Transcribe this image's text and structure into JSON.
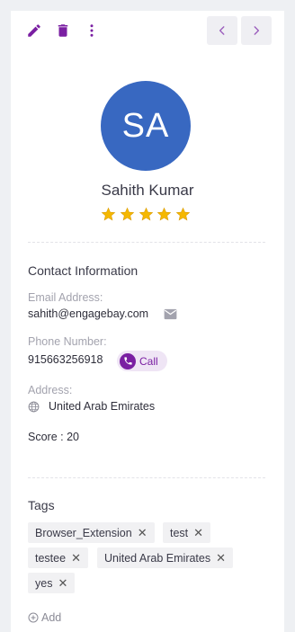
{
  "contact": {
    "initials": "SA",
    "name": "Sahith Kumar",
    "rating": 5
  },
  "contact_info": {
    "title": "Contact Information",
    "email_label": "Email Address:",
    "email": "sahith@engagebay.com",
    "phone_label": "Phone Number:",
    "phone": "915663256918",
    "call_label": "Call",
    "address_label": "Address:",
    "address": "United Arab Emirates",
    "score": "Score : 20"
  },
  "tags": {
    "title": "Tags",
    "items": [
      "Browser_Extension",
      "test",
      "testee",
      "United Arab Emirates",
      "yes"
    ],
    "add_label": "Add"
  },
  "colors": {
    "accent": "#7a1fa2",
    "avatar": "#3868c1",
    "star": "#f5b800"
  },
  "icons": [
    "edit-icon",
    "delete-icon",
    "more-vertical-icon",
    "chevron-left-icon",
    "chevron-right-icon",
    "email-icon",
    "phone-icon",
    "globe-icon",
    "close-icon",
    "add-circle-icon",
    "star-icon"
  ]
}
